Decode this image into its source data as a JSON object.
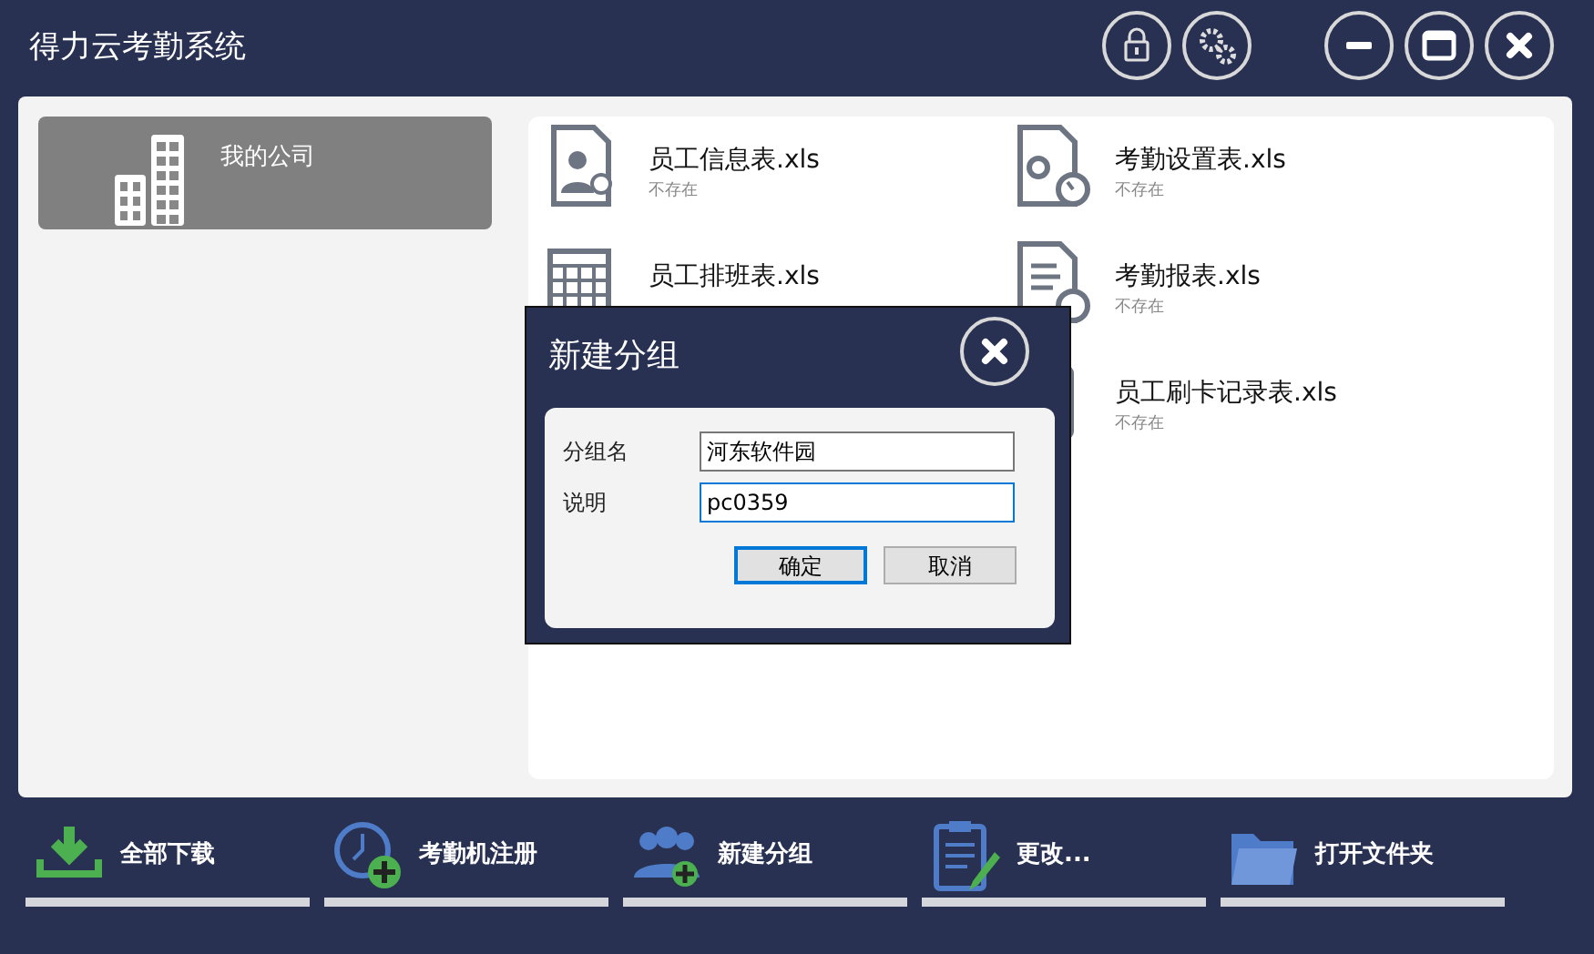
{
  "window": {
    "title": "得力云考勤系统"
  },
  "sidebar": {
    "items": [
      {
        "label": "我的公司",
        "selected": true
      }
    ]
  },
  "file_columns": [
    [
      {
        "name": "员工信息表.xls",
        "status": "不存在",
        "kind": "person"
      },
      {
        "name": "员工排班表.xls",
        "kind": "calendar"
      }
    ],
    [
      {
        "name": "考勤设置表.xls",
        "status": "不存在",
        "kind": "gears"
      },
      {
        "name": "考勤报表.xls",
        "status": "不存在",
        "kind": "report"
      },
      {
        "name": "员工刷卡记录表.xls",
        "status": "不存在",
        "kind": "card"
      }
    ]
  ],
  "dialog": {
    "title": "新建分组",
    "fields": [
      {
        "label": "分组名",
        "value": "河东软件园",
        "focused": false
      },
      {
        "label": "说明",
        "value": "pc0359",
        "focused": true
      }
    ],
    "buttons": [
      {
        "label": "确定",
        "default": true
      },
      {
        "label": "取消",
        "default": false
      }
    ]
  },
  "toolbar": [
    {
      "label": "全部下载",
      "kind": "download"
    },
    {
      "label": "考勤机注册",
      "kind": "clock"
    },
    {
      "label": "新建分组",
      "kind": "group"
    },
    {
      "label": "更改...",
      "kind": "edit"
    },
    {
      "label": "打开文件夹",
      "kind": "folder"
    }
  ]
}
